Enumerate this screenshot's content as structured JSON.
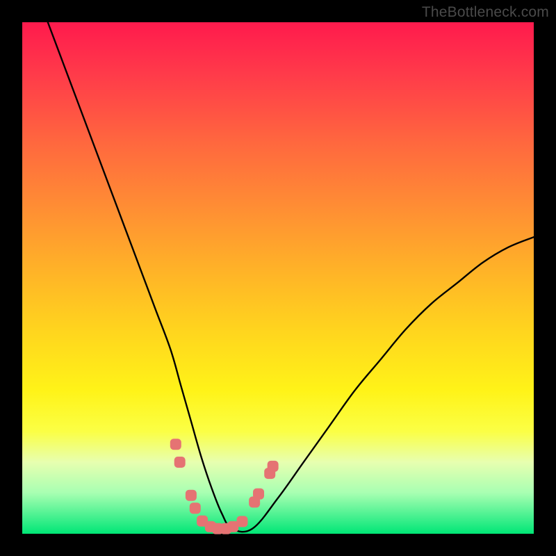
{
  "watermark": "TheBottleneck.com",
  "chart_data": {
    "type": "line",
    "title": "",
    "xlabel": "",
    "ylabel": "",
    "xlim": [
      0,
      100
    ],
    "ylim": [
      0,
      100
    ],
    "series": [
      {
        "name": "bottleneck-curve",
        "x": [
          5,
          8,
          11,
          14,
          17,
          20,
          23,
          26,
          29,
          31,
          33,
          35,
          37,
          39,
          41,
          45,
          50,
          55,
          60,
          65,
          70,
          75,
          80,
          85,
          90,
          95,
          100
        ],
        "y": [
          100,
          92,
          84,
          76,
          68,
          60,
          52,
          44,
          36,
          29,
          22,
          15,
          9,
          4,
          1,
          1,
          7,
          14,
          21,
          28,
          34,
          40,
          45,
          49,
          53,
          56,
          58
        ]
      }
    ],
    "markers": {
      "name": "data-dots",
      "color": "#e57373",
      "points": [
        {
          "x": 30.0,
          "y": 17.5
        },
        {
          "x": 30.8,
          "y": 14.0
        },
        {
          "x": 33.0,
          "y": 7.5
        },
        {
          "x": 33.8,
          "y": 5.0
        },
        {
          "x": 35.2,
          "y": 2.5
        },
        {
          "x": 36.8,
          "y": 1.4
        },
        {
          "x": 38.2,
          "y": 1.0
        },
        {
          "x": 39.8,
          "y": 1.0
        },
        {
          "x": 41.2,
          "y": 1.4
        },
        {
          "x": 43.0,
          "y": 2.4
        },
        {
          "x": 45.4,
          "y": 6.2
        },
        {
          "x": 46.2,
          "y": 7.8
        },
        {
          "x": 48.4,
          "y": 11.8
        },
        {
          "x": 49.0,
          "y": 13.2
        }
      ]
    },
    "gradient_stops": [
      {
        "pos": 0,
        "color": "#ff1a4d"
      },
      {
        "pos": 24,
        "color": "#ff693e"
      },
      {
        "pos": 48,
        "color": "#ffb128"
      },
      {
        "pos": 72,
        "color": "#fff318"
      },
      {
        "pos": 100,
        "color": "#00e676"
      }
    ]
  }
}
